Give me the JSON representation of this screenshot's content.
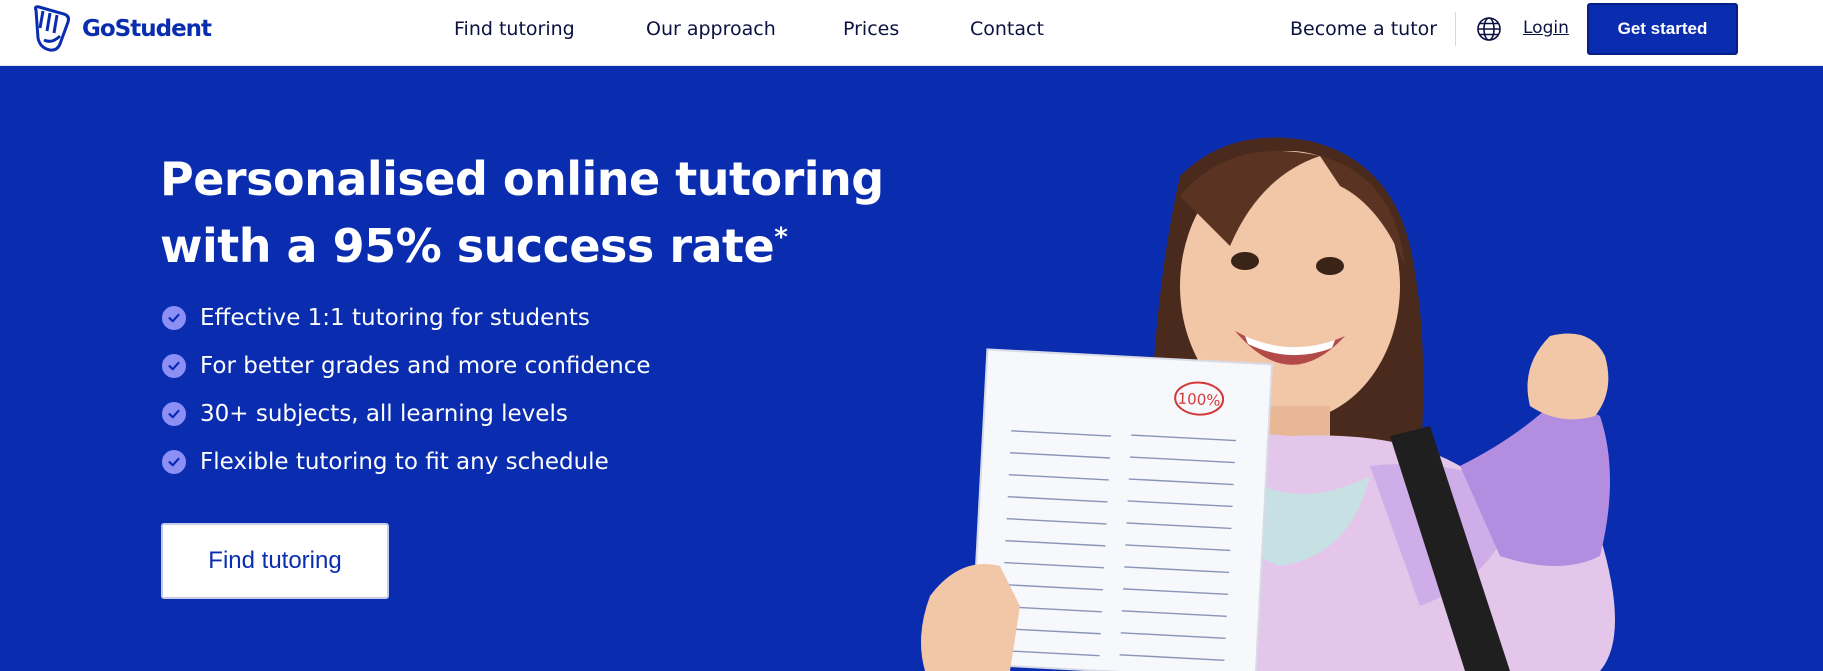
{
  "brand": {
    "name": "GoStudent"
  },
  "nav": {
    "links": [
      "Find tutoring",
      "Our approach",
      "Prices",
      "Contact"
    ],
    "become_tutor": "Become a tutor",
    "login": "Login",
    "get_started": "Get started",
    "language_icon": "globe-icon"
  },
  "hero": {
    "headline_line1": "Personalised online tutoring",
    "headline_line2": "with a 95% success rate",
    "headline_mark": "*",
    "benefits": [
      "Effective 1:1 tutoring for students",
      "For better grades and more confidence",
      "30+ subjects, all learning levels",
      "Flexible tutoring to fit any schedule"
    ],
    "cta": "Find tutoring",
    "paper_grade": "100%"
  },
  "colors": {
    "brand_blue": "#0a2db0",
    "check_purple": "#8c8ff6",
    "white": "#ffffff"
  }
}
